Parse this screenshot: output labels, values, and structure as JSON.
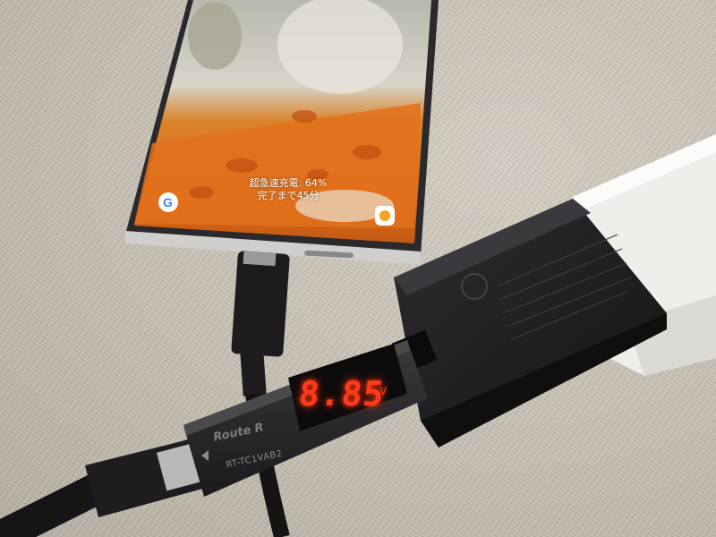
{
  "phone": {
    "charging_label": "超急速充電: 64%",
    "remaining_label": "完了まで45分"
  },
  "meter": {
    "reading": "8.85",
    "unit": "V",
    "brand": "Route R",
    "model": "RT-TC1VAB2"
  },
  "colors": {
    "fabric": "#c9c2b4",
    "meter_led": "#ff3a1a",
    "charger_body": "#1e1e20",
    "plug_white": "#efeeea"
  },
  "icons": {
    "google_app": "google-icon",
    "shortcut_app": "app-icon"
  }
}
